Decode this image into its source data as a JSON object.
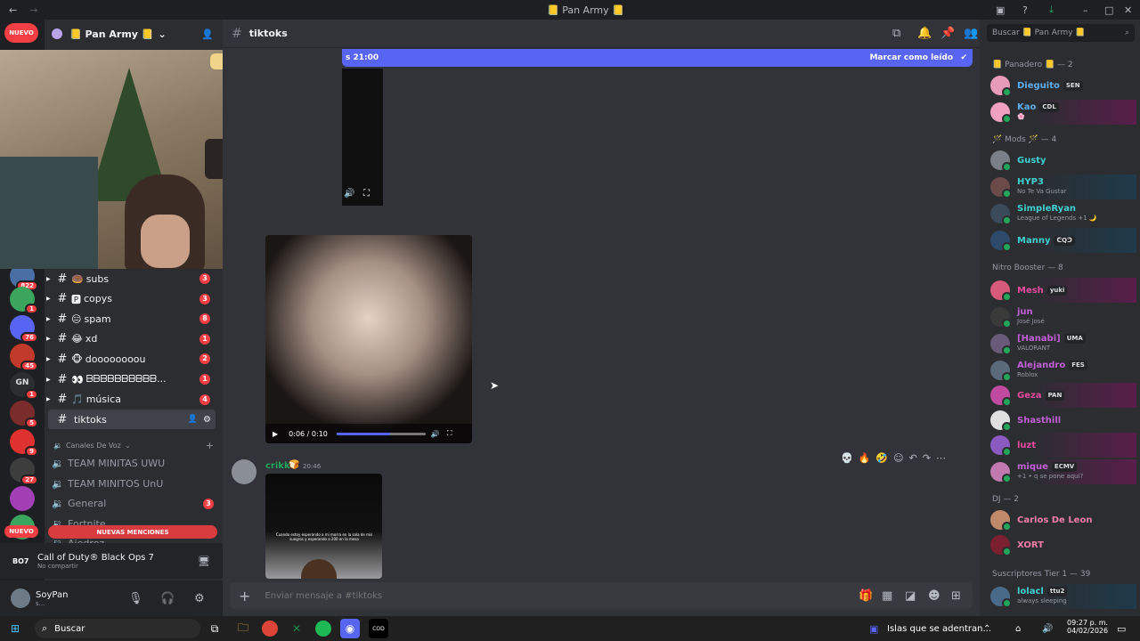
{
  "titlebar": {
    "title": "📒 Pan Army 📒"
  },
  "server": {
    "name": "📒 Pan Army 📒",
    "nuevo_label": "NUEVO"
  },
  "channel_header": {
    "name": "tiktoks",
    "search_placeholder": "Buscar 📒 Pan Army 📒"
  },
  "unread_bar": {
    "left_text": "s 21:00",
    "mark_read": "Marcar como leído"
  },
  "server_icons": [
    {
      "badge": "822",
      "color": "#4a6fa5"
    },
    {
      "badge": "1",
      "color": "#3ba55d"
    },
    {
      "badge": "76",
      "color": "#5865f2"
    },
    {
      "badge": "45",
      "color": "#c0392b"
    },
    {
      "label": "GN",
      "badge": "1",
      "color": "#2b2d31"
    },
    {
      "badge": "5",
      "color": "#7a2b2b"
    },
    {
      "badge": "9",
      "color": "#e03131"
    },
    {
      "badge": "27",
      "color": "#3d3d3d"
    },
    {
      "badge": "",
      "color": "#a33fb5"
    },
    {
      "badge": "",
      "color": "#3ba55d"
    }
  ],
  "channels": [
    {
      "icon": "🍩",
      "name": "subs",
      "badge": "3"
    },
    {
      "icon": "🅿",
      "name": "copys",
      "badge": "3"
    },
    {
      "icon": "😑",
      "name": "spam",
      "badge": "8"
    },
    {
      "icon": "😂",
      "name": "xd",
      "badge": "1"
    },
    {
      "icon": "🐵",
      "name": "doooooooou",
      "badge": "2"
    },
    {
      "icon": "👀",
      "name": "ᗷᗷᗷᗷᗷᗷᗷᗷᗷᗷ...",
      "badge": "1"
    },
    {
      "icon": "🎵",
      "name": "música",
      "badge": "4"
    },
    {
      "icon": "",
      "name": "tiktoks",
      "badge": ""
    }
  ],
  "voice": {
    "header": "Canales De Voz",
    "channels": [
      {
        "name": "TEAM MINITAS UWU",
        "badge": ""
      },
      {
        "name": "TEAM MINITOS UnU",
        "badge": ""
      },
      {
        "name": "General",
        "badge": "3"
      },
      {
        "name": "Fortnite",
        "badge": ""
      },
      {
        "name": "Ajedrez",
        "badge": ""
      }
    ],
    "new_mentions": "NUEVAS MENCIONES",
    "nuevo_label": "NUEVO"
  },
  "activity": {
    "game": "Call of Duty® Black Ops 7",
    "status": "No compartir",
    "game_abbrev": "BO7"
  },
  "user": {
    "name": "SoyPan",
    "status": "s..."
  },
  "video": {
    "time": "0:06 / 0:10",
    "progress": 0.6
  },
  "message": {
    "author": "crikk",
    "time": "20:46",
    "thumb_caption": "Cuando estoy esperando a mi morra en la sala de mis suegros y esperando a 200 en la mesa"
  },
  "composer": {
    "placeholder": "Enviar mensaje a #tiktoks"
  },
  "member_groups": [
    {
      "label": "📒 Panadero 📒 — 2"
    },
    {
      "label": "🪄 Mods 🪄 — 4"
    },
    {
      "label": "Nitro Booster — 8"
    },
    {
      "label": "DJ — 2"
    },
    {
      "label": "Suscriptores Tier 1 — 39"
    }
  ],
  "members": [
    {
      "name": "Dieguito",
      "tag": "SEN",
      "status": "",
      "color": "#5dadec"
    },
    {
      "name": "Kao",
      "tag": "CDL",
      "status": "🌸",
      "color": "#5dadec"
    },
    {
      "name": "Gusty",
      "tag": "",
      "status": "",
      "color": "#3fd0d0"
    },
    {
      "name": "HYP3",
      "tag": "",
      "status": "No Te Va Gustar",
      "color": "#3fd0d0"
    },
    {
      "name": "SimpleRyan",
      "tag": "",
      "status": "League of Legends +1 🌙",
      "color": "#3fd0d0"
    },
    {
      "name": "Manny",
      "tag": "ᕦQᕤ",
      "status": "",
      "color": "#3fd0d0"
    },
    {
      "name": "Mesh",
      "tag": "yuki",
      "status": "",
      "color": "#e84aa0"
    },
    {
      "name": "jun",
      "tag": "",
      "status": "José José",
      "color": "#c25ed6"
    },
    {
      "name": "[Hanabi]",
      "tag": "UMA",
      "status": "VALORANT",
      "color": "#c25ed6"
    },
    {
      "name": "Alejandro",
      "tag": "FES",
      "status": "Roblox",
      "color": "#c25ed6"
    },
    {
      "name": "Geza",
      "tag": "PAN",
      "status": "",
      "color": "#e84aa0"
    },
    {
      "name": "Shasthill",
      "tag": "",
      "status": "",
      "color": "#c25ed6"
    },
    {
      "name": "luzt",
      "tag": "",
      "status": "",
      "color": "#e84aa0"
    },
    {
      "name": "mique",
      "tag": "ECMV",
      "status": "+1 • q se pone aqui?",
      "color": "#c25ed6"
    },
    {
      "name": "Carlos De Leon",
      "tag": "",
      "status": "",
      "color": "#f47fa4"
    },
    {
      "name": "XORT",
      "tag": "",
      "status": "",
      "color": "#f47fa4"
    },
    {
      "name": "lolacl",
      "tag": "ttu2",
      "status": "always sleeping",
      "color": "#3fd0d0"
    }
  ],
  "taskbar": {
    "search": "Buscar",
    "media": "Islas que se adentran...",
    "time": "09:27 p. m.",
    "date": "04/02/2026"
  }
}
